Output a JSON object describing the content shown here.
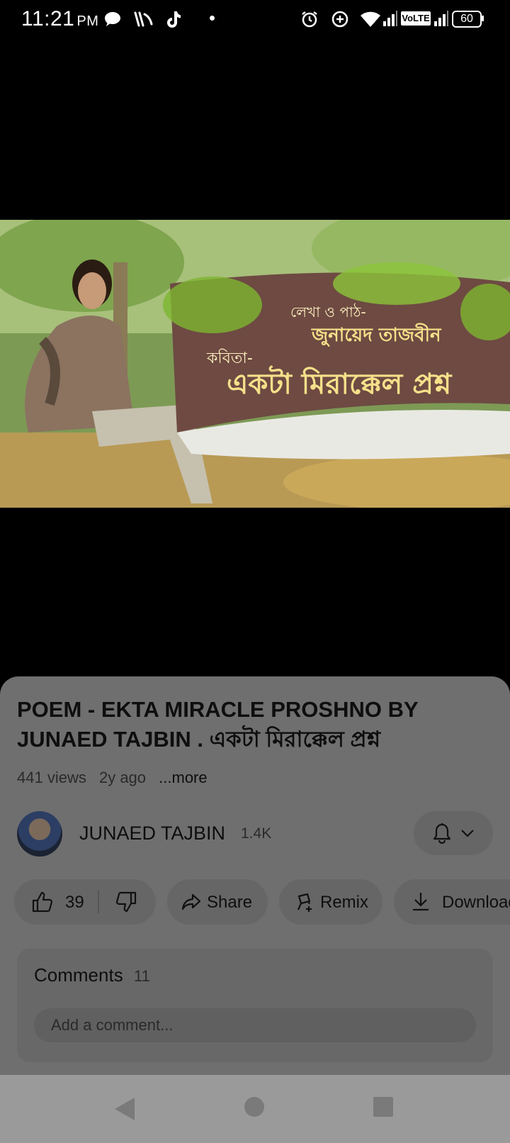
{
  "status_bar": {
    "time": "11:21",
    "ampm": "PM",
    "network_label": "VoLTE",
    "battery": "60"
  },
  "video": {
    "overlay_line1": "লেখা ও পাঠ-",
    "overlay_line2": "জুনায়েদ তাজবীন",
    "overlay_line3": "কবিতা-",
    "overlay_line4": "একটা মিরাক্কেল প্রশ্ন"
  },
  "details": {
    "title": "POEM - EKTA MIRACLE PROSHNO BY JUNAED TAJBIN . একটা মিরাক্কেল প্রশ্ন",
    "views": "441 views",
    "age": "2y ago",
    "more": "...more"
  },
  "channel": {
    "name": "JUNAED TAJBIN",
    "subscribers": "1.4K"
  },
  "actions": {
    "likes": "39",
    "share": "Share",
    "remix": "Remix",
    "download": "Download"
  },
  "comments": {
    "title": "Comments",
    "count": "11",
    "placeholder": "Add a comment..."
  }
}
